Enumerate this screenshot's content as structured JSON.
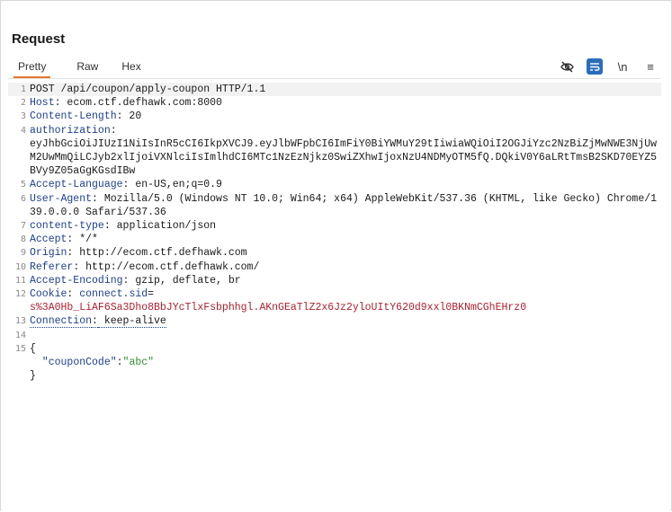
{
  "panel": {
    "title": "Request"
  },
  "tabs": [
    {
      "label": "Pretty"
    },
    {
      "label": "Raw"
    },
    {
      "label": "Hex"
    }
  ],
  "toolbar": {
    "newline_label": "\\n",
    "menu_label": "≡"
  },
  "lines": [
    {
      "n": "1",
      "text": "POST /api/coupon/apply-coupon HTTP/1.1"
    },
    {
      "n": "2",
      "key": "Host",
      "value": " ecom.ctf.defhawk.com:8000"
    },
    {
      "n": "3",
      "key": "Content-Length",
      "value": " 20"
    },
    {
      "n": "4",
      "key": "authorization",
      "value": "\neyJhbGciOiJIUzI1NiIsInR5cCI6IkpXVCJ9.eyJlbWFpbCI6ImFiY0BiYWMuY29tIiwiaWQiOiI2OGJiYzc2NzBiZjMwNWE3NjUwM2UwMmQiLCJyb2xlIjoiVXNlciIsImlhdCI6MTc1NzEzNjkz0SwiZXhwIjoxNzU4NDMyOTM5fQ.DQkiV0Y6aLRtTmsB2SKD70EYZ5BVy9Z05aGgKGsdIBw"
    },
    {
      "n": "5",
      "key": "Accept-Language",
      "value": " en-US,en;q=0.9"
    },
    {
      "n": "6",
      "key": "User-Agent",
      "value": " Mozilla/5.0 (Windows NT 10.0; Win64; x64) AppleWebKit/537.36 (KHTML, like Gecko) Chrome/139.0.0.0 Safari/537.36"
    },
    {
      "n": "7",
      "key": "content-type",
      "value": " application/json"
    },
    {
      "n": "8",
      "key": "Accept",
      "value": " */*"
    },
    {
      "n": "9",
      "key": "Origin",
      "value": " http://ecom.ctf.defhawk.com"
    },
    {
      "n": "10",
      "key": "Referer",
      "value": " http://ecom.ctf.defhawk.com/"
    },
    {
      "n": "11",
      "key": "Accept-Encoding",
      "value": " gzip, deflate, br"
    },
    {
      "n": "12",
      "key": "Cookie",
      "cookie_name": " connect.sid",
      "cookie_value": "s%3A0Hb_LiAF6Sa3Dho8BbJYcTlxFsbphhgl.AKnGEaTlZ2x6Jz2yloUItY620d9xxl0BKNmCGhEHrz0"
    },
    {
      "n": "13",
      "key": "Connection",
      "value": " keep-alive"
    },
    {
      "n": "14",
      "text": ""
    },
    {
      "n": "15",
      "text": "{"
    },
    {
      "json_key": "\"couponCode\"",
      "json_value": "\"abc\""
    },
    {
      "text": "}"
    }
  ]
}
